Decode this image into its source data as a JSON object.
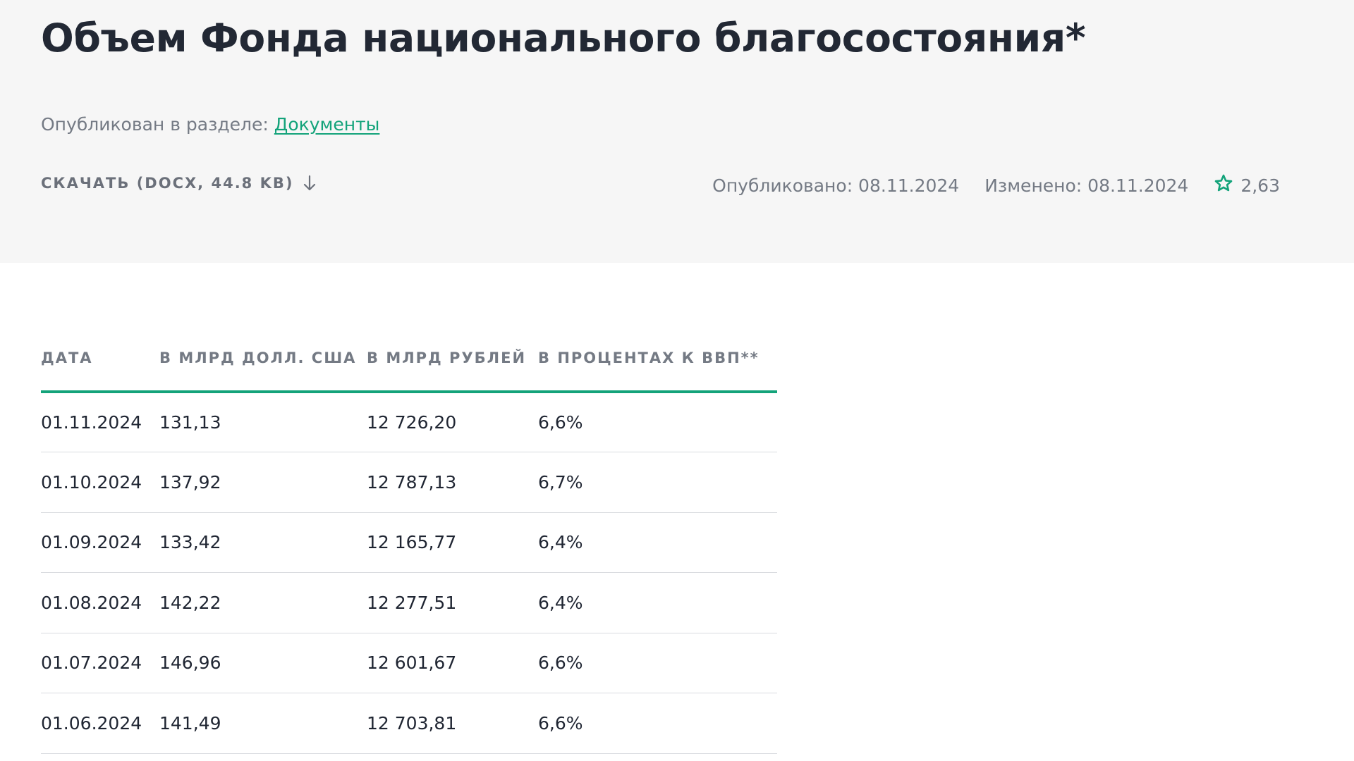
{
  "header": {
    "title": "Объем Фонда национального благосостояния*",
    "published_in_label": "Опубликован в разделе:",
    "published_in_link": "Документы",
    "download_label": "СКАЧАТЬ (DOCX, 44.8 KB)",
    "published_date": "Опубликовано: 08.11.2024",
    "modified_date": "Изменено: 08.11.2024",
    "rating": "2,63"
  },
  "table": {
    "columns": [
      "ДАТА",
      "В МЛРД ДОЛЛ. США",
      "В МЛРД РУБЛЕЙ",
      "В ПРОЦЕНТАХ К ВВП**"
    ],
    "rows": [
      [
        "01.11.2024",
        "131,13",
        "12 726,20",
        "6,6%"
      ],
      [
        "01.10.2024",
        "137,92",
        "12 787,13",
        "6,7%"
      ],
      [
        "01.09.2024",
        "133,42",
        "12 165,77",
        "6,4%"
      ],
      [
        "01.08.2024",
        "142,22",
        "12 277,51",
        "6,4%"
      ],
      [
        "01.07.2024",
        "146,96",
        "12 601,67",
        "6,6%"
      ],
      [
        "01.06.2024",
        "141,49",
        "12 703,81",
        "6,6%"
      ]
    ]
  },
  "icons": {
    "download": "arrow-down-icon",
    "rating": "star-icon"
  },
  "colors": {
    "accent": "#13a37a",
    "header_bg": "#f6f6f6",
    "text_dark": "#1f2532",
    "text_muted": "#747a84"
  }
}
